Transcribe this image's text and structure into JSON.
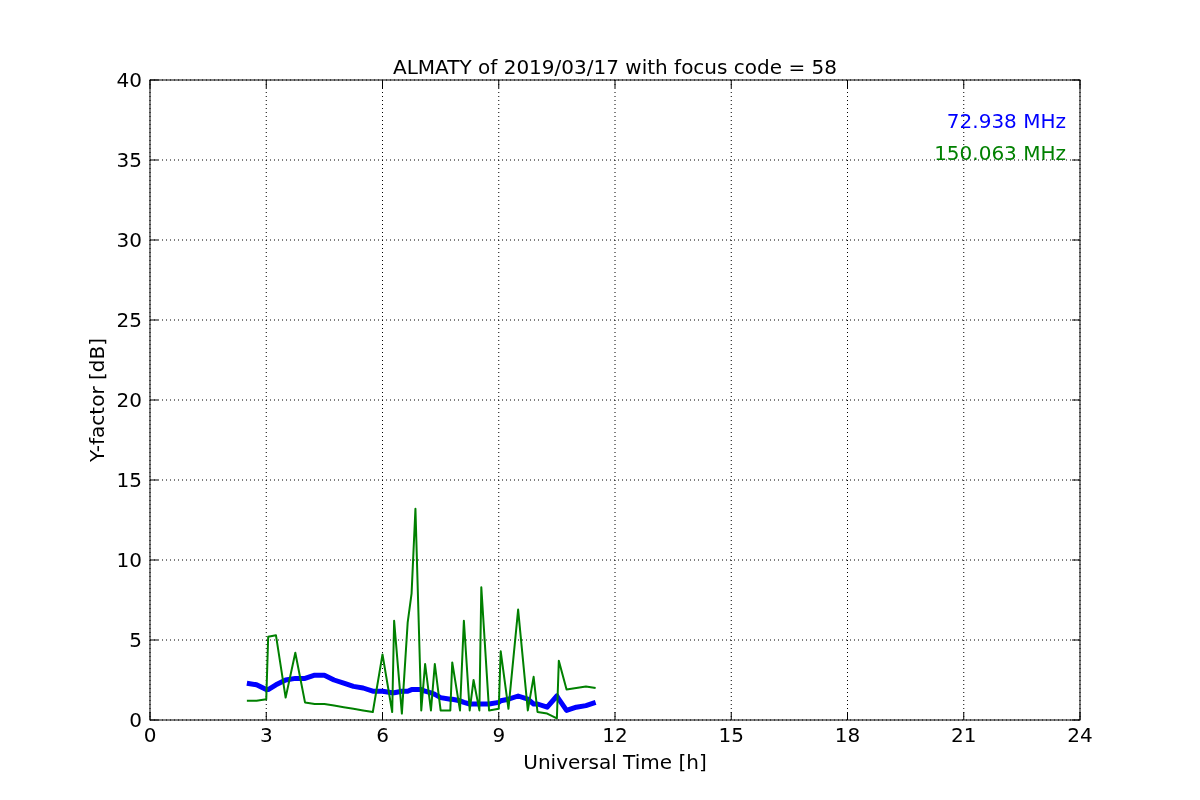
{
  "chart_data": {
    "type": "line",
    "title": "ALMATY of 2019/03/17 with focus code = 58",
    "xlabel": "Universal Time [h]",
    "ylabel": "Y-factor [dB]",
    "x": [
      2.5,
      2.75,
      3.0,
      3.05,
      3.25,
      3.5,
      3.75,
      4.0,
      4.25,
      4.5,
      4.75,
      5.0,
      5.25,
      5.5,
      5.75,
      6.0,
      6.25,
      6.3,
      6.5,
      6.65,
      6.75,
      6.85,
      7.0,
      7.1,
      7.25,
      7.35,
      7.5,
      7.75,
      7.8,
      8.0,
      8.1,
      8.25,
      8.35,
      8.5,
      8.55,
      8.75,
      9.0,
      9.05,
      9.25,
      9.5,
      9.75,
      9.9,
      10.0,
      10.25,
      10.5,
      10.55,
      10.75,
      11.0,
      11.25,
      11.5
    ],
    "series": [
      {
        "name": "72.938 MHz",
        "color": "#0000ff",
        "values": [
          2.3,
          2.2,
          1.9,
          1.9,
          2.2,
          2.5,
          2.6,
          2.6,
          2.8,
          2.8,
          2.5,
          2.3,
          2.1,
          2.0,
          1.8,
          1.8,
          1.7,
          1.7,
          1.8,
          1.8,
          1.9,
          1.9,
          1.9,
          1.8,
          1.7,
          1.6,
          1.4,
          1.3,
          1.3,
          1.2,
          1.1,
          1.0,
          1.0,
          1.0,
          1.0,
          1.0,
          1.1,
          1.2,
          1.3,
          1.5,
          1.3,
          1.0,
          1.0,
          0.8,
          1.5,
          1.3,
          0.6,
          0.8,
          0.9,
          1.1
        ]
      },
      {
        "name": "150.063 MHz",
        "color": "#008000",
        "values": [
          1.2,
          1.2,
          1.3,
          5.2,
          5.3,
          1.4,
          4.2,
          1.1,
          1.0,
          1.0,
          0.9,
          0.8,
          0.7,
          0.6,
          0.5,
          4.1,
          0.5,
          6.2,
          0.4,
          6.1,
          7.9,
          13.2,
          0.6,
          3.5,
          0.6,
          3.5,
          0.6,
          0.6,
          3.6,
          0.6,
          6.2,
          0.6,
          2.5,
          0.6,
          8.3,
          0.6,
          0.7,
          4.3,
          0.7,
          6.9,
          0.6,
          2.7,
          0.5,
          0.4,
          0.1,
          3.7,
          1.9,
          2.0,
          2.1,
          2.0
        ]
      }
    ],
    "grid": true,
    "xlim": [
      0,
      24
    ],
    "ylim": [
      0,
      40
    ],
    "xticks": [
      0,
      3,
      6,
      9,
      12,
      15,
      18,
      21,
      24
    ],
    "yticks": [
      0,
      5,
      10,
      15,
      20,
      25,
      30,
      35,
      40
    ]
  }
}
